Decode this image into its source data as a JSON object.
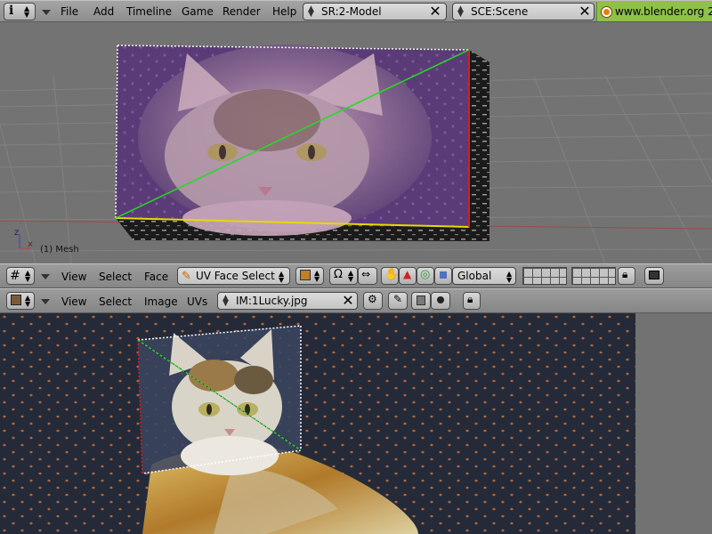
{
  "top_bar": {
    "menus": [
      "File",
      "Add",
      "Timeline",
      "Game",
      "Render",
      "Help"
    ],
    "screen_field": "SR:2-Model",
    "scene_field": "SCE:Scene",
    "url": "www.blender.org 2"
  },
  "viewport3d": {
    "object_label": "(1) Mesh",
    "axis_z": "z",
    "axis_x": "x"
  },
  "v3d_header": {
    "menus": [
      "View",
      "Select",
      "Face"
    ],
    "mode_label": "UV Face Select",
    "orientation": "Global"
  },
  "uv_header": {
    "menus": [
      "View",
      "Select",
      "Image",
      "UVs"
    ],
    "image_field": "IM:1Lucky.jpg"
  },
  "colors": {
    "header_bg": "#9a9a9a",
    "viewport_bg": "#737373",
    "grid_line": "#828282",
    "url_green": "#8ec04a",
    "uv_edge_green": "#2ecc2e",
    "selected_edge_red": "#cc2222",
    "selected_edge_yellow": "#e8d800"
  }
}
